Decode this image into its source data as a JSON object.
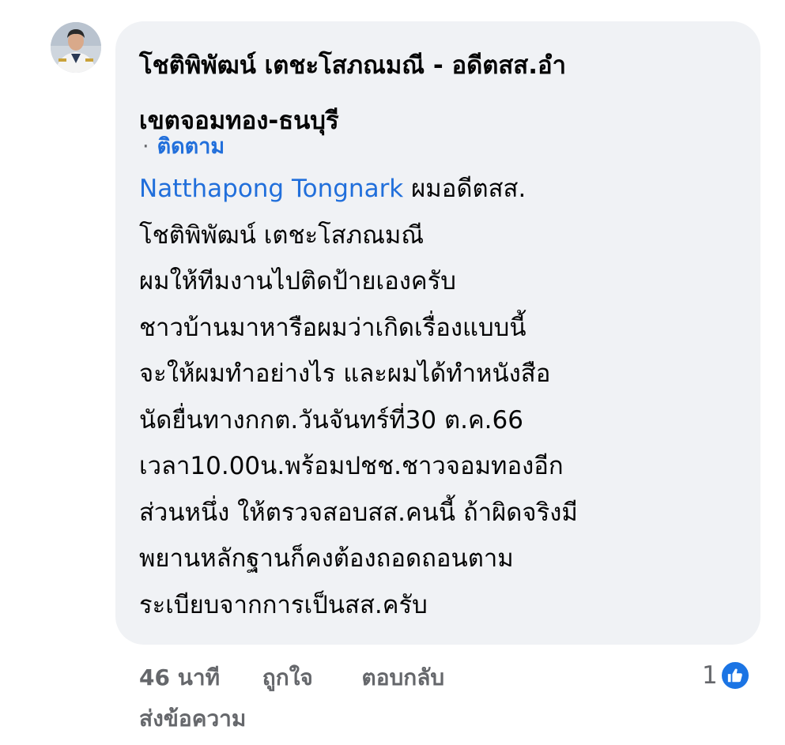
{
  "comment": {
    "author_name_line1": "โชติพิพัฒน์ เตชะโสภณมณี - อดีตสส.อำ",
    "author_name_line2": "เขตจอมทอง-ธนบุรี",
    "follow_separator": "·",
    "follow_label": "ติดตาม",
    "mention": "Natthapong Tongnark",
    "body_lines": [
      " ผมอดีตสส.",
      "โชติพิพัฒน์ เตชะโสภณมณี",
      "ผมให้ทีมงานไปติดป้ายเองครับ",
      "ชาวบ้านมาหารือผมว่าเกิดเรื่องแบบนี้",
      "จะให้ผมทำอย่างไร และผมได้ทำหนังสือ",
      "นัดยื่นทางกกต.วันจันทร์ที่30 ต.ค.66",
      "เวลา10.00น.พร้อมปชช.ชาวจอมทองอีก",
      "ส่วนหนึ่ง ให้ตรวจสอบสส.คนนี้ ถ้าผิดจริงมี",
      "พยานหลักฐานก็คงต้องถอดถอนตาม",
      "ระเบียบจากการเป็นสส.ครับ"
    ]
  },
  "actions": {
    "time": "46 นาที",
    "like": "ถูกใจ",
    "reply": "ตอบกลับ",
    "message": "ส่งข้อความ"
  },
  "reactions": {
    "count": "1",
    "icon": "like-thumb-icon",
    "color": "#1b74e4"
  },
  "colors": {
    "bubble_bg": "#f0f2f5",
    "link": "#216fdb",
    "secondary_text": "#65676b"
  }
}
